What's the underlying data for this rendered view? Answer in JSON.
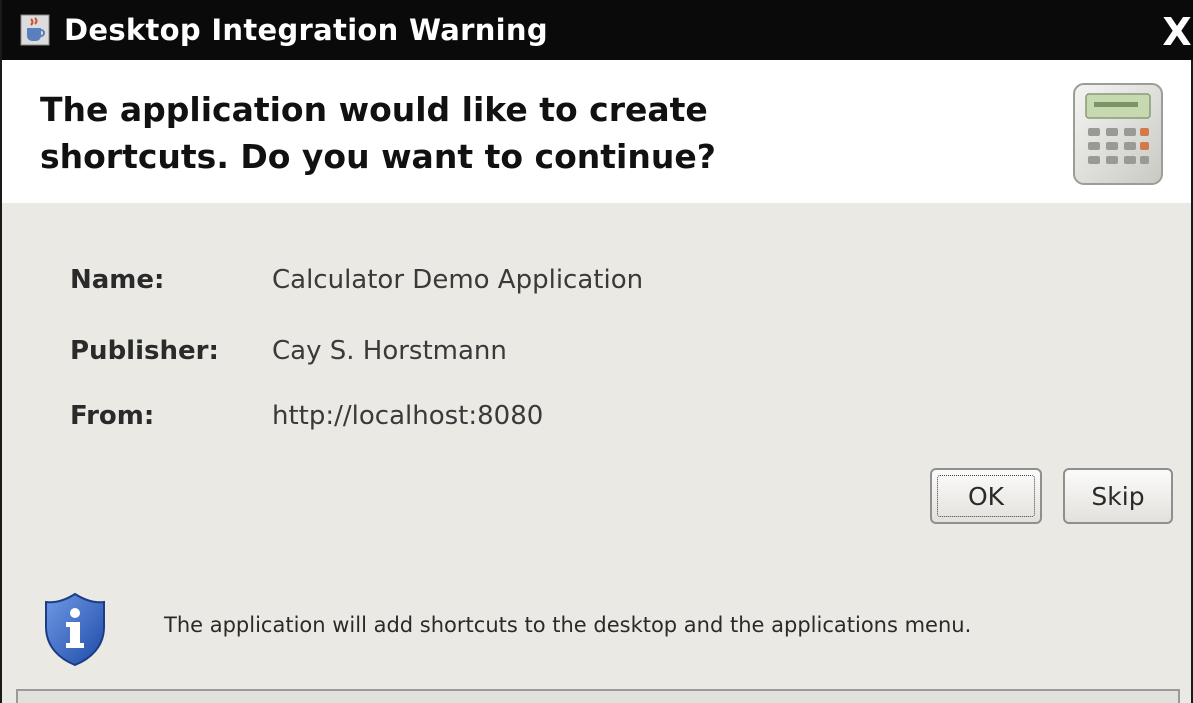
{
  "window": {
    "title": "Desktop Integration Warning",
    "close_glyph": "X",
    "app_icon": "java-cup-icon"
  },
  "header": {
    "heading_line1": "The application would like to create",
    "heading_line2": "shortcuts. Do you want to continue?",
    "icon": "calculator-icon"
  },
  "details": {
    "name_label": "Name:",
    "name_value": "Calculator Demo Application",
    "publisher_label": "Publisher:",
    "publisher_value": "Cay S. Horstmann",
    "from_label": "From:",
    "from_value": "http://localhost:8080"
  },
  "buttons": {
    "ok_label": "OK",
    "skip_label": "Skip"
  },
  "footer": {
    "icon": "info-shield-icon",
    "message": "The application will add shortcuts to the desktop and the applications menu."
  },
  "colors": {
    "titlebar": "#0a0a0a",
    "body": "#ebe9e4",
    "header": "#ffffff",
    "shield_blue": "#2f62c8"
  }
}
